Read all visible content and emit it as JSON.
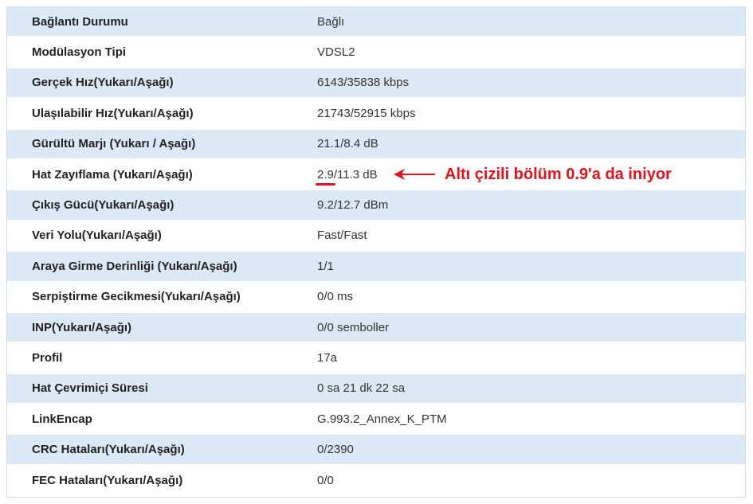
{
  "rows": [
    {
      "label": "Bağlantı Durumu",
      "value": "Bağlı"
    },
    {
      "label": "Modülasyon Tipi",
      "value": "VDSL2"
    },
    {
      "label": "Gerçek Hız(Yukarı/Aşağı)",
      "value": "6143/35838 kbps"
    },
    {
      "label": "Ulaşılabilir Hız(Yukarı/Aşağı)",
      "value": "21743/52915 kbps"
    },
    {
      "label": "Gürültü Marjı (Yukarı / Aşağı)",
      "value": "21.1/8.4 dB"
    },
    {
      "label": "Hat Zayıflama (Yukarı/Aşağı)",
      "value_highlight": "2.9",
      "value_rest": "/11.3 dB"
    },
    {
      "label": "Çıkış Gücü(Yukarı/Aşağı)",
      "value": "9.2/12.7 dBm"
    },
    {
      "label": "Veri Yolu(Yukarı/Aşağı)",
      "value": "Fast/Fast"
    },
    {
      "label": "Araya Girme Derinliği (Yukarı/Aşağı)",
      "value": "1/1"
    },
    {
      "label": "Serpiştirme Gecikmesi(Yukarı/Aşağı)",
      "value": "0/0 ms"
    },
    {
      "label": "INP(Yukarı/Aşağı)",
      "value": "0/0 semboller"
    },
    {
      "label": "Profil",
      "value": "17a"
    },
    {
      "label": "Hat Çevrimiçi Süresi",
      "value": "0 sa 21 dk 22 sa"
    },
    {
      "label": "LinkEncap",
      "value": "G.993.2_Annex_K_PTM"
    },
    {
      "label": "CRC Hataları(Yukarı/Aşağı)",
      "value": "0/2390"
    },
    {
      "label": "FEC Hataları(Yukarı/Aşağı)",
      "value": "0/0"
    }
  ],
  "annotation": {
    "text": "Altı çizili bölüm 0.9'a da iniyor",
    "color": "#e8101a"
  },
  "colors": {
    "row_odd": "#dbe9f6",
    "row_even": "#ffffff",
    "border": "#d4dde6"
  }
}
